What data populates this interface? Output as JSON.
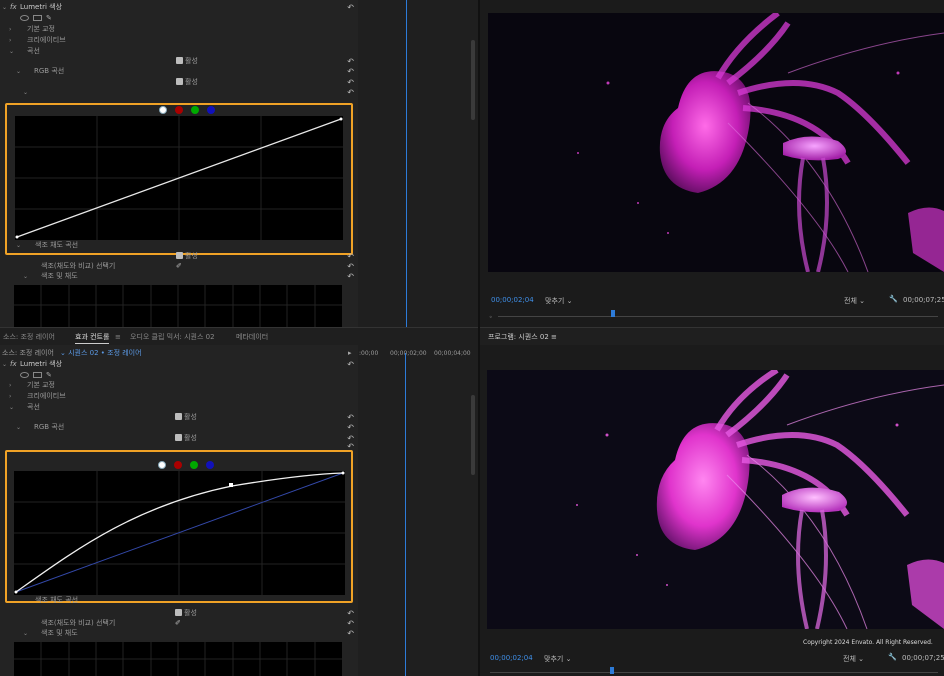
{
  "top": {
    "fx_label": "fx",
    "effect_name": "Lumetri 색상",
    "rows": [
      {
        "label": "기본 교정"
      },
      {
        "label": "크리에이티브"
      },
      {
        "label": "곡선"
      },
      {
        "label": "RGB 곡선"
      },
      {
        "label": "색조 채도 곡선"
      },
      {
        "label": "색조(채도와 비교) 선택기"
      },
      {
        "label": "색조 및 채도"
      }
    ],
    "enable_label": "활성",
    "curve_type": "linear"
  },
  "tabs": {
    "source": "소스: 조정 레이어",
    "effect_controls": "효과 컨트롤",
    "menu": "≡",
    "audio_mixer": "오디오 클립 믹서: 시퀀스 02",
    "metadata": "메타데이터",
    "program": "프로그램: 시퀀스 02"
  },
  "bottom": {
    "source_label": "소스: 조정 레이어",
    "clip_label": "시퀀스 02 • 조정 레이어",
    "timeline_start": ":00;00",
    "timeline_mid": "00;00;02;00",
    "timeline_end": "00;00;04;00",
    "fx_label": "fx",
    "effect_name": "Lumetri 색상",
    "rows": [
      {
        "label": "기본 교정"
      },
      {
        "label": "크리에이티브"
      },
      {
        "label": "곡선"
      },
      {
        "label": "RGB 곡선"
      },
      {
        "label": "색조 채도 곡선"
      },
      {
        "label": "색조(채도와 비교) 선택기"
      },
      {
        "label": "색조 및 채도"
      }
    ],
    "enable_label": "활성",
    "curve_type": "s-curve"
  },
  "monitors": {
    "top": {
      "timecode": "00;00;02;04",
      "fit": "맞추기",
      "quality": "전체",
      "duration": "00;00;07;25"
    },
    "bottom": {
      "timecode": "00;00;02;04",
      "fit": "맞추기",
      "quality": "전체",
      "duration": "00;00;07;25",
      "copyright": "Copyright 2024 Envato. All Right Reserved."
    }
  },
  "colors": {
    "accent_orange": "#f0a226",
    "timecode_blue": "#3f8fe8",
    "jelly_magenta": "#d93bd6"
  }
}
